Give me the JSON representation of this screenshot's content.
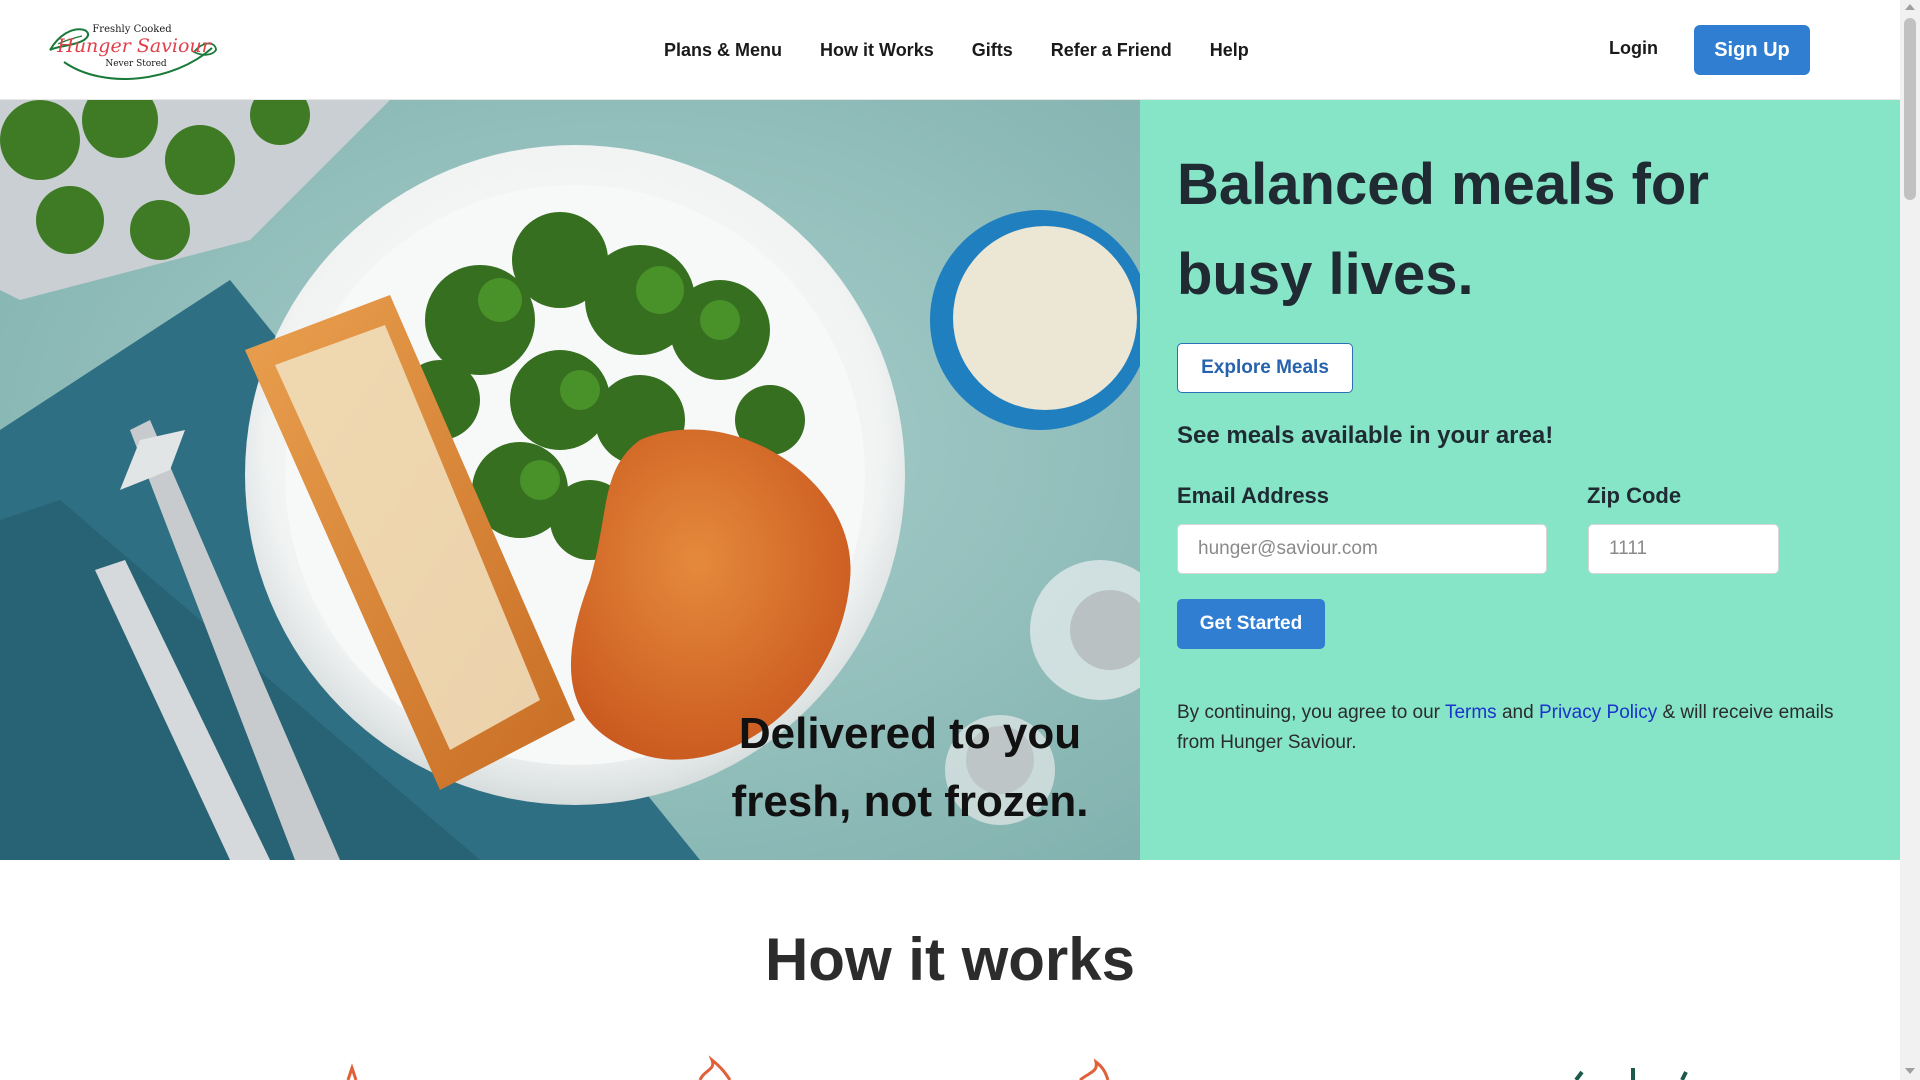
{
  "logo": {
    "tagline_top": "Freshly Cooked",
    "brand": "Hunger Saviour",
    "tagline_bottom": "Never Stored"
  },
  "nav": {
    "items": [
      {
        "label": "Plans & Menu"
      },
      {
        "label": "How it Works"
      },
      {
        "label": "Gifts"
      },
      {
        "label": "Refer a Friend"
      },
      {
        "label": "Help"
      }
    ],
    "login": "Login",
    "signup": "Sign Up"
  },
  "hero": {
    "title": "Balanced meals for busy lives.",
    "explore_button": "Explore Meals",
    "area_text": "See meals available in your area!",
    "email_label": "Email Address",
    "email_placeholder": "hunger@saviour.com",
    "zip_label": "Zip Code",
    "zip_placeholder": "1111",
    "start_button": "Get Started",
    "consent_prefix": "By continuing, you agree to our",
    "terms_link": "Terms",
    "consent_and": "and",
    "privacy_link": "Privacy Policy",
    "consent_suffix": "& will receive emails from Hunger Saviour.",
    "image_caption": "Delivered to you fresh, not frozen."
  },
  "how_it_works": {
    "title": "How it works"
  },
  "colors": {
    "primary": "#2f7ed1",
    "panel_bg": "#86e5c6",
    "link": "#1a33cc",
    "image_bg": "#8fbab8"
  }
}
